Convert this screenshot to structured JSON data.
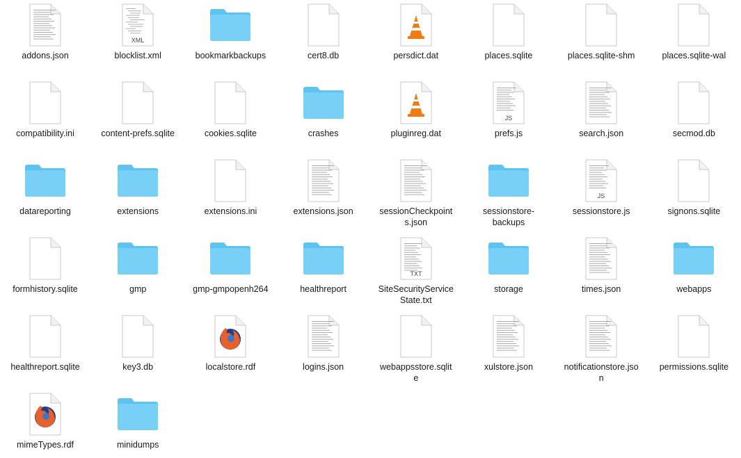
{
  "window": {
    "view": "icon-view"
  },
  "colors": {
    "folder": "#5dc3f0",
    "folder_top": "#79d0f6",
    "doc_border": "#c8c8c8",
    "doc_fill": "#ffffff",
    "vlc_orange": "#f07c15",
    "firefox_orange": "#e6612b",
    "firefox_blue": "#1e3f8c"
  },
  "files": [
    {
      "name": "addons.json",
      "icon": "text-document-icon"
    },
    {
      "name": "blocklist.xml",
      "icon": "xml-document-icon",
      "badge": "XML"
    },
    {
      "name": "bookmarkbackups",
      "icon": "folder-icon"
    },
    {
      "name": "cert8.db",
      "icon": "blank-document-icon"
    },
    {
      "name": "persdict.dat",
      "icon": "vlc-document-icon"
    },
    {
      "name": "places.sqlite",
      "icon": "blank-document-icon"
    },
    {
      "name": "places.sqlite-shm",
      "icon": "blank-document-icon"
    },
    {
      "name": "places.sqlite-wal",
      "icon": "blank-document-icon"
    },
    {
      "name": "compatibility.ini",
      "icon": "blank-document-icon"
    },
    {
      "name": "content-prefs.sqlite",
      "icon": "blank-document-icon"
    },
    {
      "name": "cookies.sqlite",
      "icon": "blank-document-icon"
    },
    {
      "name": "crashes",
      "icon": "folder-icon"
    },
    {
      "name": "pluginreg.dat",
      "icon": "vlc-document-icon"
    },
    {
      "name": "prefs.js",
      "icon": "js-document-icon",
      "badge": "JS"
    },
    {
      "name": "search.json",
      "icon": "text-document-icon"
    },
    {
      "name": "secmod.db",
      "icon": "blank-document-icon"
    },
    {
      "name": "datareporting",
      "icon": "folder-icon"
    },
    {
      "name": "extensions",
      "icon": "folder-icon"
    },
    {
      "name": "extensions.ini",
      "icon": "blank-document-icon"
    },
    {
      "name": "extensions.json",
      "icon": "text-document-icon"
    },
    {
      "name": "sessionCheckpoints.json",
      "label": "sessionCheckpoint\ns.json",
      "icon": "text-document-icon"
    },
    {
      "name": "sessionstore-backups",
      "label": "sessionstore-\nbackups",
      "icon": "folder-icon"
    },
    {
      "name": "sessionstore.js",
      "icon": "js-document-icon",
      "badge": "JS"
    },
    {
      "name": "signons.sqlite",
      "icon": "blank-document-icon"
    },
    {
      "name": "formhistory.sqlite",
      "icon": "blank-document-icon"
    },
    {
      "name": "gmp",
      "icon": "folder-icon"
    },
    {
      "name": "gmp-gmpopenh264",
      "icon": "folder-icon"
    },
    {
      "name": "healthreport",
      "icon": "folder-icon"
    },
    {
      "name": "SiteSecurityServiceState.txt",
      "label": "SiteSecurityService\nState.txt",
      "icon": "txt-document-icon",
      "badge": "TXT"
    },
    {
      "name": "storage",
      "icon": "folder-icon"
    },
    {
      "name": "times.json",
      "icon": "text-document-icon"
    },
    {
      "name": "webapps",
      "icon": "folder-icon"
    },
    {
      "name": "healthreport.sqlite",
      "icon": "blank-document-icon"
    },
    {
      "name": "key3.db",
      "icon": "blank-document-icon"
    },
    {
      "name": "localstore.rdf",
      "icon": "firefox-document-icon"
    },
    {
      "name": "logins.json",
      "icon": "text-document-icon"
    },
    {
      "name": "webappsstore.sqlite",
      "label": "webappsstore.sqlit\ne",
      "icon": "blank-document-icon"
    },
    {
      "name": "xulstore.json",
      "icon": "text-document-icon"
    },
    {
      "name": "notificationstore.json",
      "label": "notificationstore.jso\nn",
      "icon": "text-document-icon"
    },
    {
      "name": "permissions.sqlite",
      "icon": "blank-document-icon"
    },
    {
      "name": "mimeTypes.rdf",
      "icon": "firefox-document-icon"
    },
    {
      "name": "minidumps",
      "icon": "folder-icon"
    }
  ]
}
